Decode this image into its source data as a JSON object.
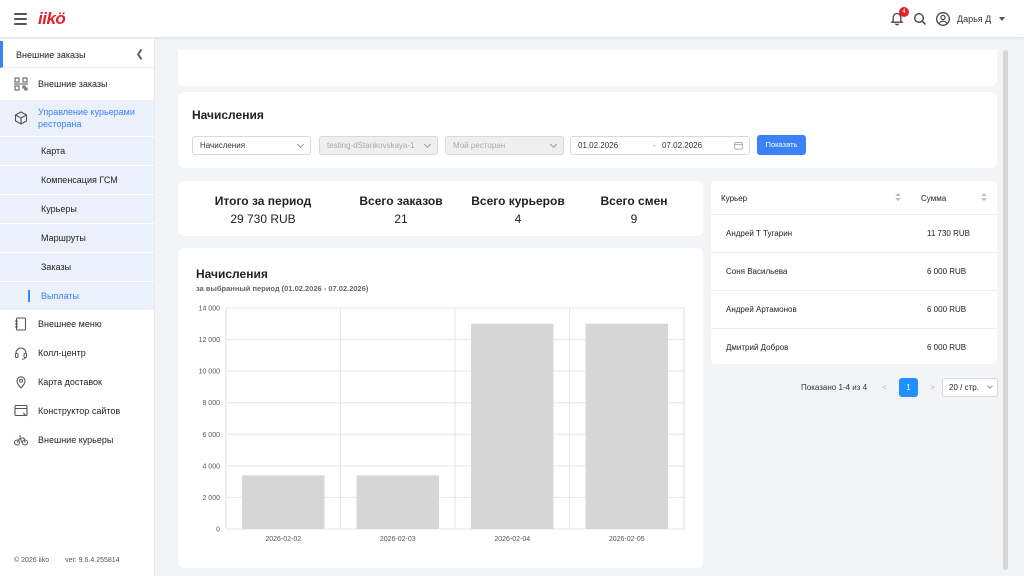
{
  "topbar": {
    "logo": "iikö",
    "notification_count": "4",
    "user_name": "Дарья Д"
  },
  "sidebar": {
    "header": "Внешние заказы",
    "items": [
      {
        "label": "Внешние заказы",
        "icon": "qr-code-icon"
      },
      {
        "label": "Управление курьерами ресторана",
        "icon": "box-icon"
      },
      {
        "label": "Карта"
      },
      {
        "label": "Компенсация ГСМ"
      },
      {
        "label": "Курьеры"
      },
      {
        "label": "Маршруты"
      },
      {
        "label": "Заказы"
      },
      {
        "label": "Выплаты"
      },
      {
        "label": "Внешнее меню",
        "icon": "menu-book-icon"
      },
      {
        "label": "Колл-центр",
        "icon": "headset-icon"
      },
      {
        "label": "Карта доставок",
        "icon": "map-pin-icon"
      },
      {
        "label": "Конструктор сайтов",
        "icon": "browser-window-icon"
      },
      {
        "label": "Внешние курьеры",
        "icon": "bicycle-icon"
      }
    ],
    "footer": {
      "copyright": "© 2026 iiko",
      "version": "ver: 9.6.4.255814"
    }
  },
  "filters": {
    "title": "Начисления",
    "type_select": "Начисления",
    "org_select": "testing-dStankovskaya-1",
    "restaurant_select": "Мой ресторан",
    "date_from": "01.02.2026",
    "date_separator": "-",
    "date_to": "07.02.2026",
    "show_button": "Показать"
  },
  "stats": [
    {
      "title": "Итого за период",
      "value": "29 730 RUB"
    },
    {
      "title": "Всего заказов",
      "value": "21"
    },
    {
      "title": "Всего курьеров",
      "value": "4"
    },
    {
      "title": "Всего смен",
      "value": "9"
    }
  ],
  "chart_card": {
    "title": "Начисления",
    "subtitle": "за выбранный период (01.02.2026 - 07.02.2026)"
  },
  "chart_data": {
    "type": "bar",
    "categories": [
      "2026-02-02",
      "2026-02-03",
      "2026-02-04",
      "2026-02-05"
    ],
    "values": [
      3400,
      3400,
      13000,
      13000
    ],
    "ylim": [
      0,
      14000
    ],
    "yticks": [
      "14 000",
      "12 000",
      "10 000",
      "8 000",
      "6 000",
      "4 000",
      "2 000",
      "0"
    ],
    "grid": true,
    "bar_color": "#d6d6d6"
  },
  "table": {
    "columns": [
      "Курьер",
      "Сумма"
    ],
    "rows": [
      {
        "courier": "Андрей Т Тугарин",
        "amount": "11 730 RUB"
      },
      {
        "courier": "Соня Васильева",
        "amount": "6 000 RUB"
      },
      {
        "courier": "Андрей Артамонов",
        "amount": "6 000 RUB"
      },
      {
        "courier": "Дмитрий Добров",
        "amount": "6 000 RUB"
      }
    ]
  },
  "pagination": {
    "summary": "Показано 1-4 из 4",
    "prev": "<",
    "current": "1",
    "next": ">",
    "page_size": "20 / стр."
  },
  "colors": {
    "accent": "#3b82f6",
    "logo": "#e3232c",
    "badge": "#e3232c"
  }
}
